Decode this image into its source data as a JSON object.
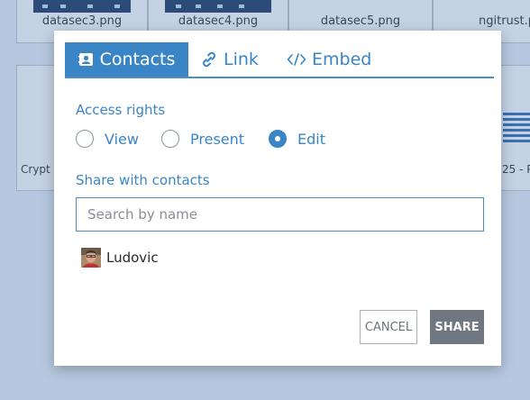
{
  "background": {
    "files_row1": [
      "datasec3.png",
      "datasec4.png",
      "datasec5.png",
      "ngitrust.p"
    ],
    "partial_left": "Crypt",
    "partial_right": "25 - P"
  },
  "dialog": {
    "tabs": [
      {
        "label": "Contacts",
        "icon": "contacts-card-icon",
        "active": true
      },
      {
        "label": "Link",
        "icon": "link-icon",
        "active": false
      },
      {
        "label": "Embed",
        "icon": "code-icon",
        "active": false
      }
    ],
    "access_rights": {
      "label": "Access rights",
      "options": [
        {
          "label": "View",
          "checked": false
        },
        {
          "label": "Present",
          "checked": false
        },
        {
          "label": "Edit",
          "checked": true
        }
      ]
    },
    "share_with": {
      "label": "Share with contacts",
      "search_placeholder": "Search by name"
    },
    "contacts": [
      {
        "name": "Ludovic"
      }
    ],
    "buttons": {
      "cancel": "CANCEL",
      "share": "SHARE"
    }
  },
  "colors": {
    "accent": "#3a85c6",
    "share_button": "#6f7780",
    "backdrop": "#b6c8df"
  }
}
